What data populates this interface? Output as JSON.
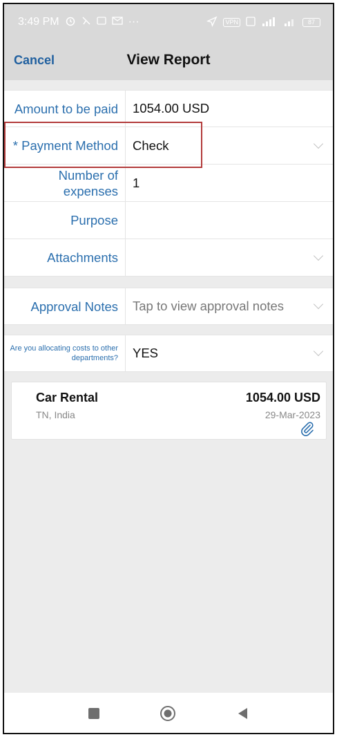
{
  "status_bar": {
    "time": "3:49 PM",
    "icons": [
      "alarm-icon",
      "signal-slash-icon",
      "message-icon",
      "mail-icon",
      "more-dots-icon"
    ],
    "right_icons": [
      "location-arrow-icon",
      "vpn-icon",
      "hd-icon",
      "signal-5g-icon",
      "signal-icon",
      "battery-icon"
    ],
    "vpn_label": "VPN",
    "battery_level": "87"
  },
  "nav": {
    "cancel_label": "Cancel",
    "title": "View Report"
  },
  "form": {
    "amount_label": "Amount to be paid",
    "amount_value": "1054.00 USD",
    "payment_method_label": "* Payment Method",
    "payment_method_value": "Check",
    "num_expenses_label": "Number of expenses",
    "num_expenses_value": "1",
    "purpose_label": "Purpose",
    "purpose_value": "",
    "attachments_label": "Attachments",
    "attachments_value": "",
    "approval_notes_label": "Approval Notes",
    "approval_notes_placeholder": "Tap to view approval notes",
    "allocating_label": "Are you allocating costs to other departments?",
    "allocating_value": "YES"
  },
  "expense": {
    "title": "Car Rental",
    "amount": "1054.00 USD",
    "location": "TN, India",
    "date": "29-Mar-2023",
    "attachment_icon": "paperclip-icon"
  },
  "bottom_nav": {
    "icons": [
      "square-recents-icon",
      "circle-home-icon",
      "triangle-back-icon"
    ]
  },
  "colors": {
    "accent": "#2b6fae",
    "header_bg": "#d9d9d9",
    "highlight": "#b23a3a"
  }
}
